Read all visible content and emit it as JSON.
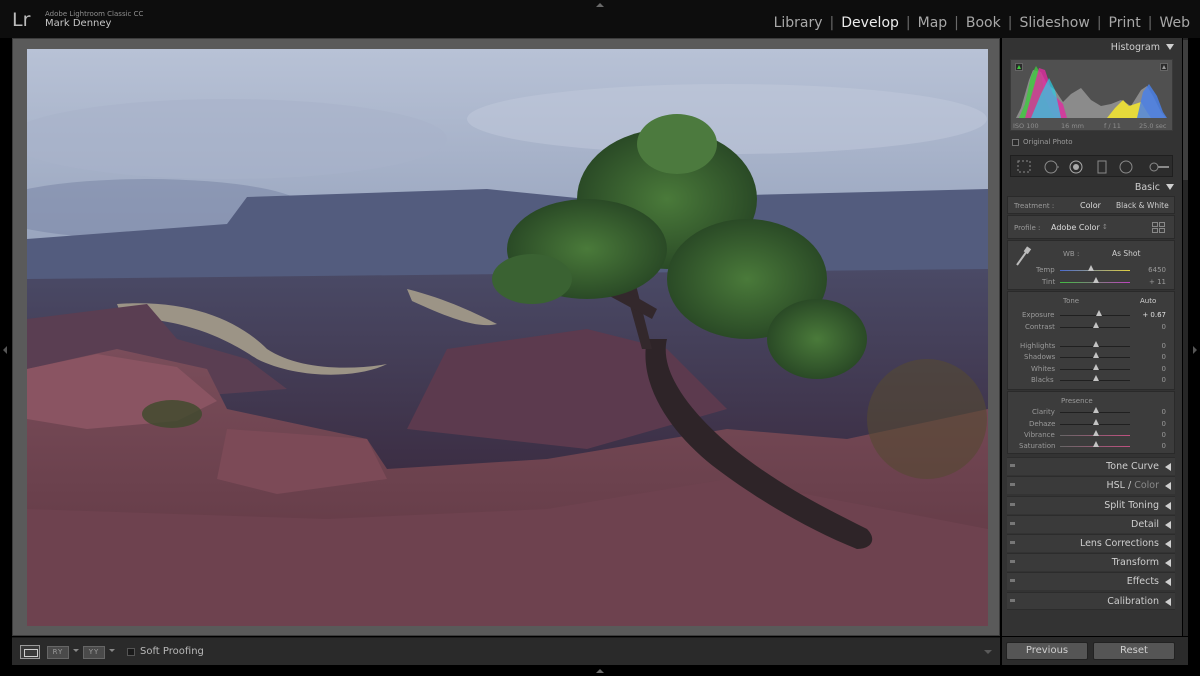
{
  "app": {
    "logo": "Lr",
    "name": "Adobe Lightroom Classic CC",
    "user": "Mark Denney"
  },
  "modules": [
    "Library",
    "Develop",
    "Map",
    "Book",
    "Slideshow",
    "Print",
    "Web"
  ],
  "active_module": "Develop",
  "toolbar": {
    "soft_proofing_label": "Soft Proofing",
    "ry_label": "RY",
    "yy_label": "YY"
  },
  "histogram": {
    "title": "Histogram",
    "iso": "ISO 100",
    "focal": "16 mm",
    "aperture": "f / 11",
    "shutter": "25.0 sec",
    "original_photo_label": "Original Photo"
  },
  "basic": {
    "title": "Basic",
    "treatment_label": "Treatment :",
    "treatment_color": "Color",
    "treatment_bw": "Black & White",
    "profile_label": "Profile :",
    "profile_value": "Adobe Color",
    "profile_caret": "↕",
    "wb_label": "WB :",
    "wb_value": "As Shot",
    "temp_label": "Temp",
    "temp_value": "6450",
    "tint_label": "Tint",
    "tint_value": "+ 11",
    "tone_label": "Tone",
    "auto_label": "Auto",
    "exposure_label": "Exposure",
    "exposure_value": "+ 0.67",
    "contrast_label": "Contrast",
    "contrast_value": "0",
    "highlights_label": "Highlights",
    "highlights_value": "0",
    "shadows_label": "Shadows",
    "shadows_value": "0",
    "whites_label": "Whites",
    "whites_value": "0",
    "blacks_label": "Blacks",
    "blacks_value": "0",
    "presence_label": "Presence",
    "clarity_label": "Clarity",
    "clarity_value": "0",
    "dehaze_label": "Dehaze",
    "dehaze_value": "0",
    "vibrance_label": "Vibrance",
    "vibrance_value": "0",
    "saturation_label": "Saturation",
    "saturation_value": "0"
  },
  "panels": {
    "tone_curve": "Tone Curve",
    "hsl": "HSL",
    "hsl_sep": " / ",
    "color": "Color",
    "split_toning": "Split Toning",
    "detail": "Detail",
    "lens_corrections": "Lens Corrections",
    "transform": "Transform",
    "effects": "Effects",
    "calibration": "Calibration"
  },
  "buttons": {
    "previous": "Previous",
    "reset": "Reset"
  },
  "icons": {
    "tools": [
      "crop-overlay-icon",
      "spot-removal-icon",
      "red-eye-icon",
      "graduated-filter-icon",
      "radial-filter-icon",
      "adjustment-brush-icon"
    ],
    "profile_browser": "grid-icon",
    "wb_selector": "eyedropper-icon"
  },
  "colors": {
    "panel_bg": "#333333",
    "section_bg": "#3c3c3c",
    "text": "#cfcfcf",
    "center_bg": "#5a5a5a"
  }
}
